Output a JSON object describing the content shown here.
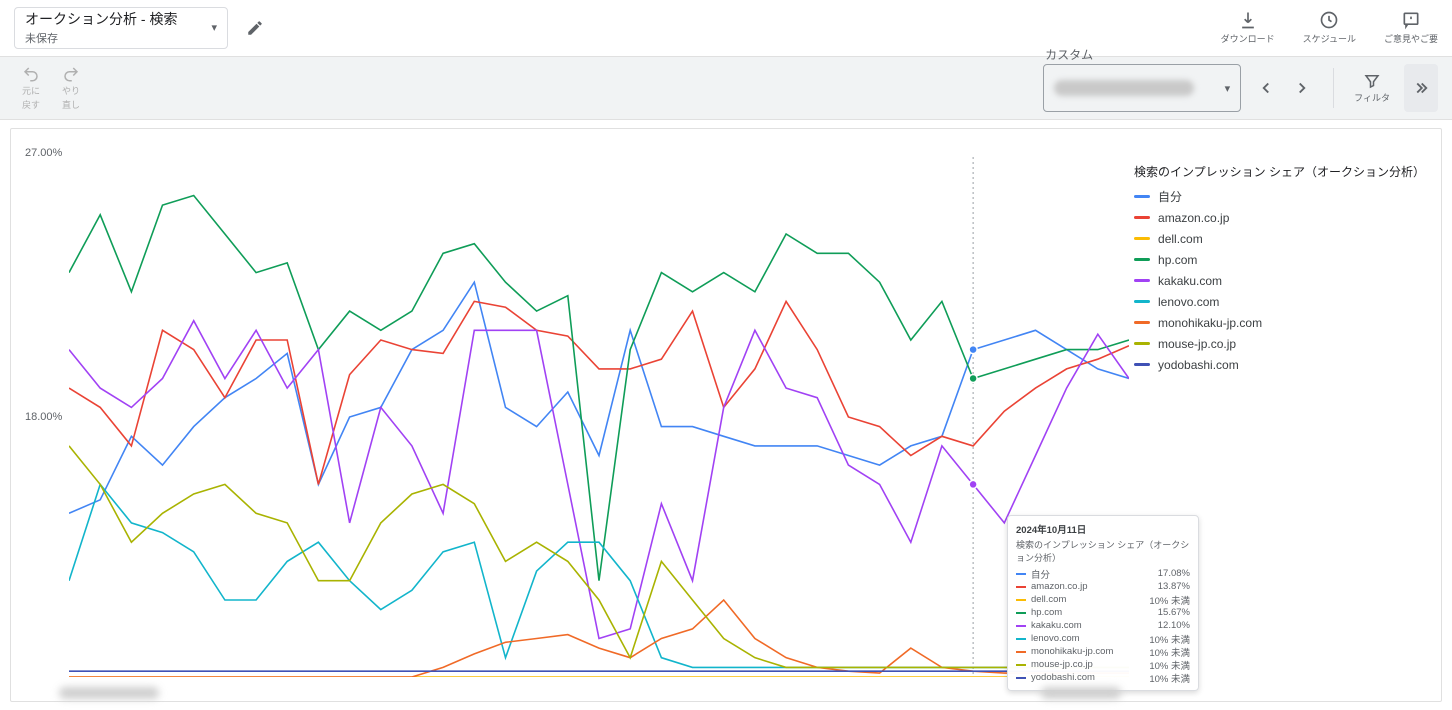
{
  "header": {
    "title": "オークション分析 - 検索",
    "subtitle": "未保存",
    "download_label": "ダウンロード",
    "schedule_label": "スケジュール",
    "feedback_label": "ご意見やご要"
  },
  "toolbar": {
    "undo_label": "元に",
    "redo_label": "やり",
    "back_label": "戻す",
    "cancel_label": "直し",
    "custom_label": "カスタム",
    "filter_label": "フィルタ"
  },
  "chart_data": {
    "type": "line",
    "title": "検索のインプレッション シェア（オークション分析）",
    "ylabel": "",
    "xlabel": "",
    "ylim": [
      0,
      27
    ],
    "yticks": [
      27.0,
      18.0
    ],
    "ytick_labels": [
      "27.00%",
      "18.00%"
    ],
    "series": [
      {
        "name": "自分",
        "color": "#4285f4",
        "values": [
          8.5,
          9.2,
          12.5,
          11.0,
          13.0,
          14.5,
          15.5,
          16.8,
          10.0,
          13.5,
          14.0,
          17.0,
          18.0,
          20.5,
          14.0,
          13.0,
          14.8,
          11.5,
          18.0,
          13.0,
          13.0,
          12.5,
          12.0,
          12.0,
          12.0,
          11.5,
          11.0,
          12.0,
          12.5,
          17.0,
          17.5,
          18.0,
          17.0,
          16.0,
          15.5
        ]
      },
      {
        "name": "amazon.co.jp",
        "color": "#ea4335",
        "values": [
          15.0,
          14.0,
          12.0,
          18.0,
          17.0,
          14.5,
          17.5,
          17.5,
          10.0,
          15.7,
          17.5,
          17.0,
          16.8,
          19.5,
          19.2,
          18.0,
          17.7,
          16.0,
          16.0,
          16.5,
          19.0,
          14.0,
          16.0,
          19.5,
          17.0,
          13.5,
          13.0,
          11.5,
          12.5,
          12.0,
          13.8,
          15.0,
          16.0,
          16.5,
          17.2
        ]
      },
      {
        "name": "dell.com",
        "color": "#fbbc04",
        "values": [
          0,
          0,
          0,
          0,
          0,
          0,
          0,
          0,
          0,
          0,
          0,
          0,
          0,
          0,
          0,
          0,
          0,
          0,
          0,
          0,
          0,
          0,
          0,
          0,
          0,
          0,
          0,
          0,
          0,
          0,
          0,
          0,
          0,
          0,
          0
        ]
      },
      {
        "name": "hp.com",
        "color": "#0f9d58",
        "values": [
          21.0,
          24.0,
          20.0,
          24.5,
          25.0,
          23.0,
          21.0,
          21.5,
          17.0,
          19.0,
          18.0,
          19.0,
          22.0,
          22.5,
          20.5,
          19.0,
          19.8,
          5.0,
          17.0,
          21.0,
          20.0,
          21.0,
          20.0,
          23.0,
          22.0,
          22.0,
          20.5,
          17.5,
          19.5,
          15.5,
          16.0,
          16.5,
          17.0,
          17.0,
          17.5
        ]
      },
      {
        "name": "kakaku.com",
        "color": "#a142f4",
        "values": [
          17.0,
          15.0,
          14.0,
          15.5,
          18.5,
          15.5,
          18.0,
          15.0,
          17.0,
          8.0,
          14.0,
          12.0,
          8.5,
          18.0,
          18.0,
          18.0,
          10.0,
          2.0,
          2.5,
          9.0,
          5.0,
          14.0,
          18.0,
          15.0,
          14.5,
          11.0,
          10.0,
          7.0,
          12.0,
          10.0,
          8.0,
          11.5,
          15.0,
          17.8,
          15.5
        ]
      },
      {
        "name": "lenovo.com",
        "color": "#12b5cb",
        "values": [
          5.0,
          10.0,
          8.0,
          7.5,
          6.5,
          4.0,
          4.0,
          6.0,
          7.0,
          5.0,
          3.5,
          4.5,
          6.5,
          7.0,
          1.0,
          5.5,
          7.0,
          7.0,
          5.0,
          1.0,
          0.5,
          0.5,
          0.5,
          0.5,
          0.5,
          0.5,
          0.5,
          0.5,
          0.5,
          0.5,
          0.5,
          0.5,
          0.5,
          0.5,
          0.5
        ]
      },
      {
        "name": "monohikaku-jp.com",
        "color": "#f06a27",
        "values": [
          0,
          0,
          0,
          0,
          0,
          0,
          0,
          0,
          0,
          0,
          0,
          0,
          0.5,
          1.2,
          1.8,
          2.0,
          2.2,
          1.5,
          1.0,
          2.0,
          2.5,
          4.0,
          2.0,
          1.0,
          0.5,
          0.3,
          0.2,
          1.5,
          0.5,
          0.3,
          0.2,
          0.2,
          0.2,
          0.2,
          0.2
        ]
      },
      {
        "name": "mouse-jp.co.jp",
        "color": "#a9b301",
        "values": [
          12.0,
          10.0,
          7.0,
          8.5,
          9.5,
          10.0,
          8.5,
          8.0,
          5.0,
          5.0,
          8.0,
          9.5,
          10.0,
          9.0,
          6.0,
          7.0,
          6.0,
          4.0,
          1.0,
          6.0,
          4.0,
          2.0,
          1.0,
          0.5,
          0.5,
          0.5,
          0.5,
          0.5,
          0.5,
          0.5,
          0.5,
          0.5,
          0.5,
          0.5,
          0.5
        ]
      },
      {
        "name": "yodobashi.com",
        "color": "#3f51b5",
        "values": [
          0.3,
          0.3,
          0.3,
          0.3,
          0.3,
          0.3,
          0.3,
          0.3,
          0.3,
          0.3,
          0.3,
          0.3,
          0.3,
          0.3,
          0.3,
          0.3,
          0.3,
          0.3,
          0.3,
          0.3,
          0.3,
          0.3,
          0.3,
          0.3,
          0.3,
          0.3,
          0.3,
          0.3,
          0.3,
          0.3,
          0.3,
          0.3,
          0.3,
          0.3,
          0.3
        ]
      }
    ],
    "hover": {
      "x_index": 29,
      "date": "2024年10月11日",
      "metric": "検索のインプレッション シェア（オークション分析）",
      "rows": [
        {
          "name": "自分",
          "value": "17.08%",
          "color": "#4285f4"
        },
        {
          "name": "amazon.co.jp",
          "value": "13.87%",
          "color": "#ea4335"
        },
        {
          "name": "dell.com",
          "value": "10% 未満",
          "color": "#fbbc04"
        },
        {
          "name": "hp.com",
          "value": "15.67%",
          "color": "#0f9d58"
        },
        {
          "name": "kakaku.com",
          "value": "12.10%",
          "color": "#a142f4"
        },
        {
          "name": "lenovo.com",
          "value": "10% 未満",
          "color": "#12b5cb"
        },
        {
          "name": "monohikaku-jp.com",
          "value": "10% 未満",
          "color": "#f06a27"
        },
        {
          "name": "mouse-jp.co.jp",
          "value": "10% 未満",
          "color": "#a9b301"
        },
        {
          "name": "yodobashi.com",
          "value": "10% 未満",
          "color": "#3f51b5"
        }
      ]
    }
  }
}
